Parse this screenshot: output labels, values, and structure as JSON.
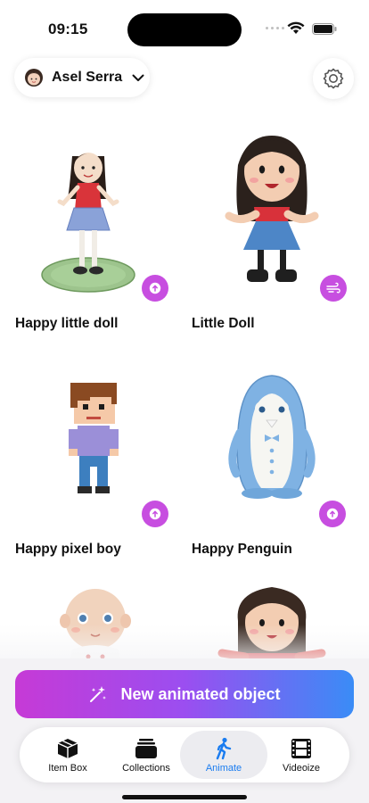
{
  "status": {
    "time": "09:15"
  },
  "header": {
    "profile_name": "Asel Serra"
  },
  "objects": [
    {
      "title": "Happy little doll",
      "badge_icon": "upload-arrow-icon"
    },
    {
      "title": "Little Doll",
      "badge_icon": "wind-icon"
    },
    {
      "title": "Happy pixel boy",
      "badge_icon": "upload-arrow-icon"
    },
    {
      "title": "Happy Penguin",
      "badge_icon": "upload-arrow-icon"
    }
  ],
  "cta": {
    "label": "New animated object",
    "icon": "sparkle-wand-icon"
  },
  "tabs": [
    {
      "label": "Item Box",
      "icon": "box-icon",
      "active": false
    },
    {
      "label": "Collections",
      "icon": "stack-icon",
      "active": false
    },
    {
      "label": "Animate",
      "icon": "walking-figure-icon",
      "active": true
    },
    {
      "label": "Videoize",
      "icon": "film-icon",
      "active": false
    }
  ],
  "colors": {
    "accent_blue": "#1a7cf0",
    "badge_purple": "#c74ee0",
    "cta_start": "#c63ad6",
    "cta_end": "#3a8cf6"
  }
}
